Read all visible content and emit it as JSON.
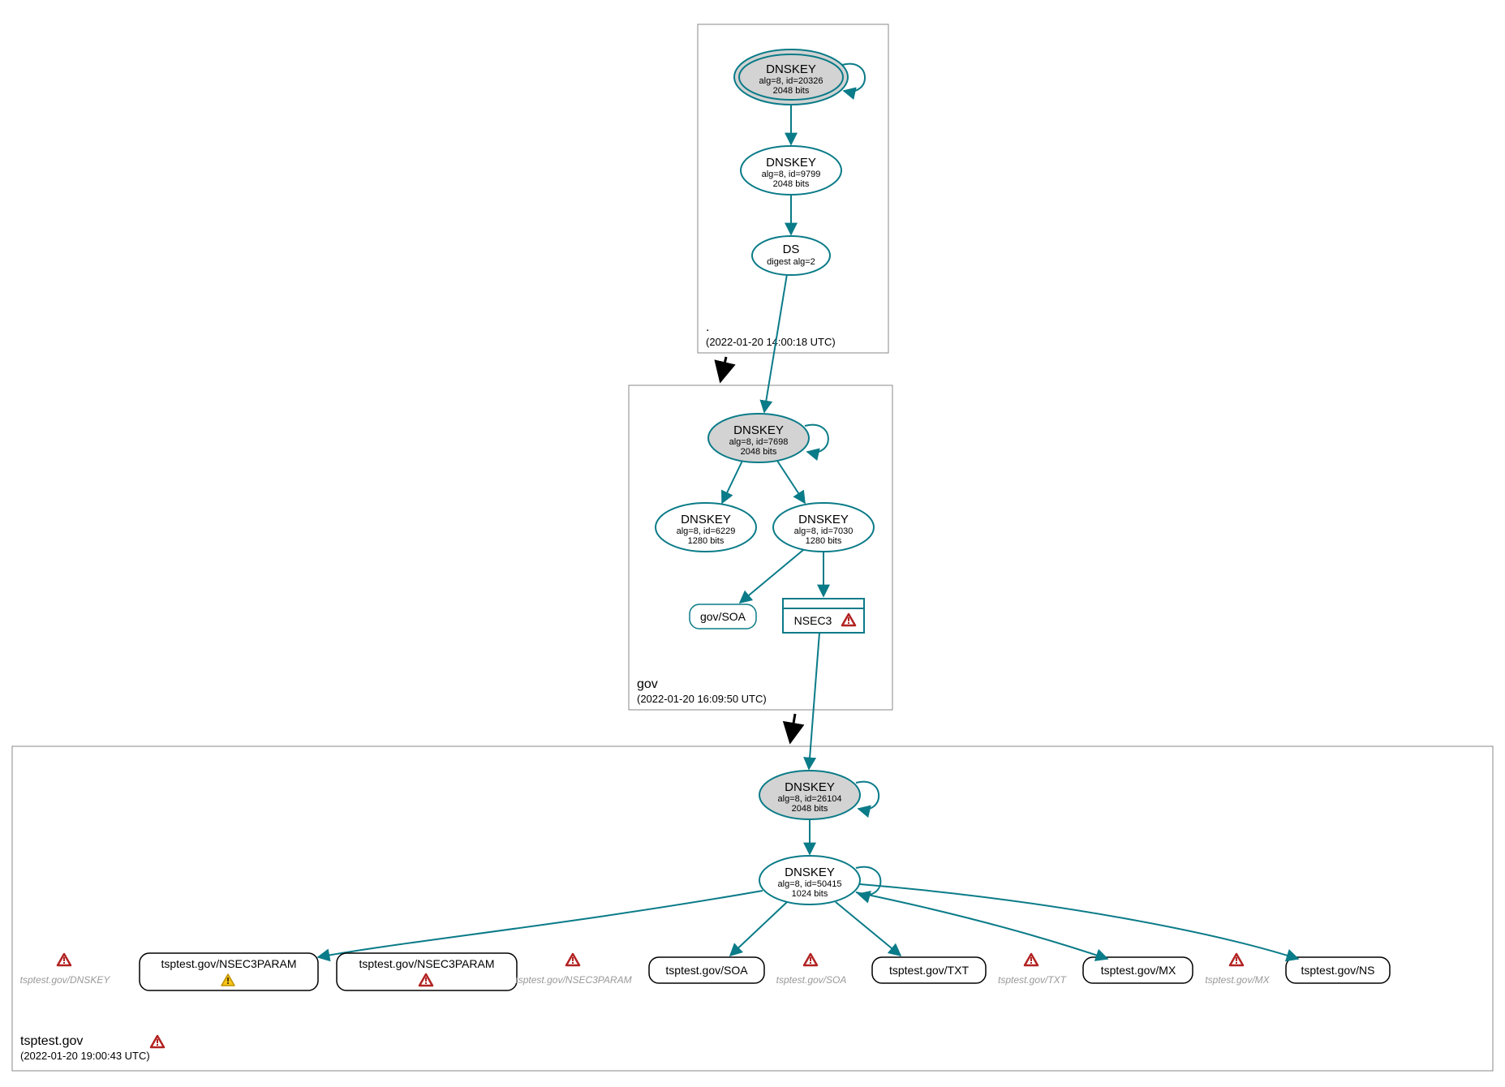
{
  "zones": {
    "root": {
      "name": ".",
      "time": "(2022-01-20 14:00:18 UTC)"
    },
    "gov": {
      "name": "gov",
      "time": "(2022-01-20 16:09:50 UTC)"
    },
    "tsp": {
      "name": "tsptest.gov",
      "time": "(2022-01-20 19:00:43 UTC)"
    }
  },
  "nodes": {
    "root_ksk": {
      "title": "DNSKEY",
      "line1": "alg=8, id=20326",
      "line2": "2048 bits"
    },
    "root_zsk": {
      "title": "DNSKEY",
      "line1": "alg=8, id=9799",
      "line2": "2048 bits"
    },
    "root_ds": {
      "title": "DS",
      "line1": "digest alg=2"
    },
    "gov_ksk": {
      "title": "DNSKEY",
      "line1": "alg=8, id=7698",
      "line2": "2048 bits"
    },
    "gov_zsk1": {
      "title": "DNSKEY",
      "line1": "alg=8, id=6229",
      "line2": "1280 bits"
    },
    "gov_zsk2": {
      "title": "DNSKEY",
      "line1": "alg=8, id=7030",
      "line2": "1280 bits"
    },
    "gov_soa": {
      "label": "gov/SOA"
    },
    "gov_nsec3": {
      "label": "NSEC3"
    },
    "tsp_ksk": {
      "title": "DNSKEY",
      "line1": "alg=8, id=26104",
      "line2": "2048 bits"
    },
    "tsp_zsk": {
      "title": "DNSKEY",
      "line1": "alg=8, id=50415",
      "line2": "1024 bits"
    }
  },
  "rrsets": {
    "nsec3p1": "tsptest.gov/NSEC3PARAM",
    "nsec3p2": "tsptest.gov/NSEC3PARAM",
    "soa": "tsptest.gov/SOA",
    "txt": "tsptest.gov/TXT",
    "mx": "tsptest.gov/MX",
    "ns": "tsptest.gov/NS"
  },
  "ghosts": {
    "dnskey": "tsptest.gov/DNSKEY",
    "nsec3p": "tsptest.gov/NSEC3PARAM",
    "soa": "tsptest.gov/SOA",
    "txt": "tsptest.gov/TXT",
    "mx": "tsptest.gov/MX"
  },
  "colors": {
    "teal": "#0a7b88",
    "warn_red": "#b22222",
    "warn_yellow": "#f5c518"
  }
}
